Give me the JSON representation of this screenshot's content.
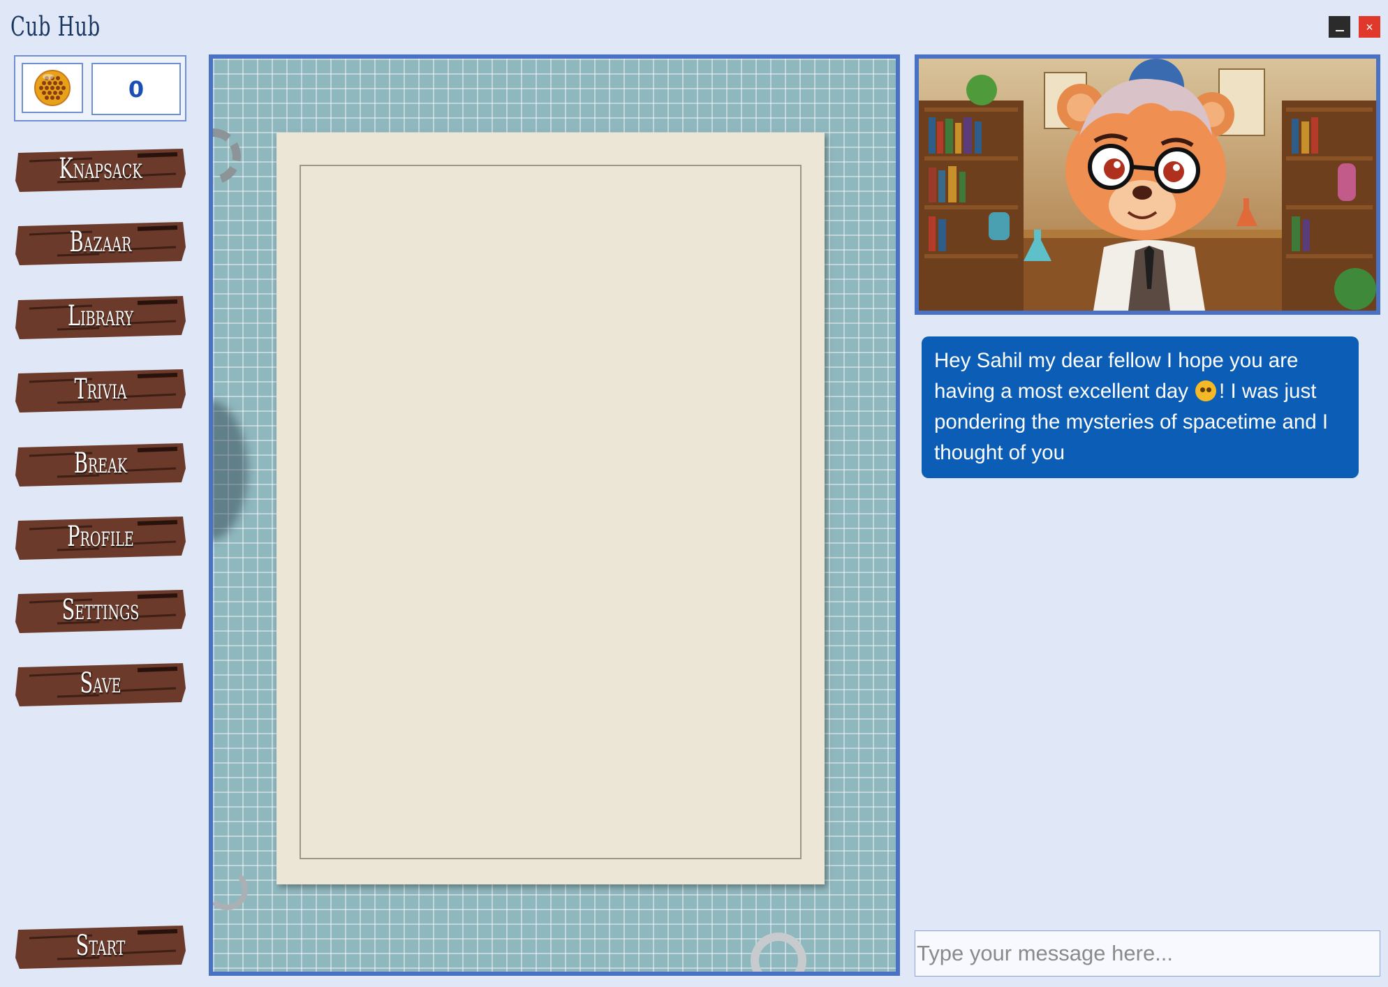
{
  "window": {
    "title": "Cub Hub",
    "minimize_label": "_",
    "close_label": "×"
  },
  "score": {
    "value": "0",
    "icon": "honeycomb-icon"
  },
  "menu": {
    "items": [
      {
        "label": "Knapsack"
      },
      {
        "label": "Bazaar"
      },
      {
        "label": "Library"
      },
      {
        "label": "Trivia"
      },
      {
        "label": "Break"
      },
      {
        "label": "Profile"
      },
      {
        "label": "Settings"
      },
      {
        "label": "Save"
      }
    ],
    "start_label": "Start"
  },
  "chat": {
    "message_before_emoji": "Hey Sahil my dear fellow I hope you are having a most excellent day",
    "emoji": "upside-down-face-emoji",
    "message_after_emoji": "! I was just pondering the mysteries of spacetime and I thought of you",
    "input_placeholder": "Type your message here..."
  },
  "colors": {
    "background": "#e0e7f6",
    "accent_border": "#4a72c4",
    "bubble": "#0b5db5",
    "plank_wood": "#6b3a2a",
    "close_button": "#e0392b"
  }
}
